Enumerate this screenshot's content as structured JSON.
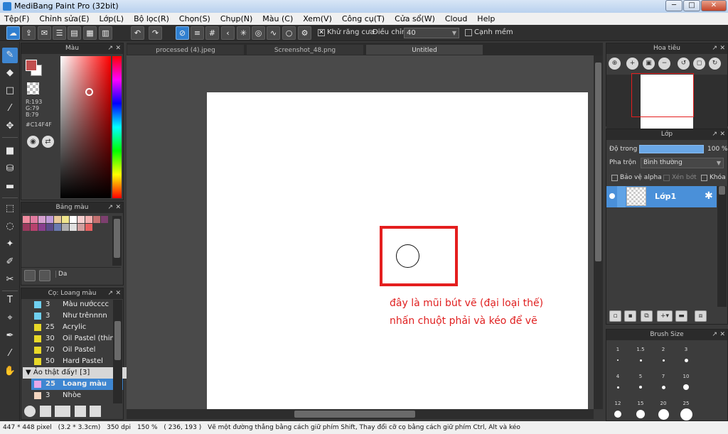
{
  "window": {
    "title": "MediBang Paint Pro (32bit)",
    "min": "─",
    "max": "□",
    "close": "✕"
  },
  "menu": [
    "Tệp(F)",
    "Chỉnh sửa(E)",
    "Lớp(L)",
    "Bộ lọc(R)",
    "Chọn(S)",
    "Chụp(N)",
    "Màu (C)",
    "Xem(V)",
    "Công cụ(T)",
    "Cửa sổ(W)",
    "Cloud",
    "Help"
  ],
  "toolbar": {
    "antialias_label": "Khử răng cưa",
    "correction_label": "Điều chỉnh",
    "correction_value": "40",
    "edge_label": "Cạnh mềm"
  },
  "color_panel": {
    "title": "Màu",
    "r": "R:193",
    "g": "G:79",
    "b": "B:79",
    "hex": "#C14F4F"
  },
  "palette_panel": {
    "title": "Bảng màu",
    "colors": [
      "#f08ca0",
      "#e27ba0",
      "#d6a0d0",
      "#c09ad8",
      "#e8c89a",
      "#f0e68c",
      "#ffffff",
      "#f8d0d0",
      "#f4b0b0",
      "#c47070",
      "#7d3f6f",
      "#9c3a5e",
      "#b8426e",
      "#8a3f8f",
      "#5c4a8a",
      "#6a7ab0",
      "#b0b0b0",
      "#e0e0e0",
      "#d0a0a0",
      "#e86060"
    ],
    "name": "Da"
  },
  "brush_panel": {
    "title": "Cọ: Loang màu",
    "items": [
      {
        "size": "3",
        "name": "Màu nướcccc",
        "color": "#6fd0f0"
      },
      {
        "size": "3",
        "name": "Như trênnnn",
        "color": "#6fd0f0"
      },
      {
        "size": "25",
        "name": "Acrylic",
        "color": "#e8d828"
      },
      {
        "size": "30",
        "name": "Oil Pastel (thin)",
        "color": "#e8d828"
      },
      {
        "size": "70",
        "name": "Oil Pastel",
        "color": "#e8d828"
      },
      {
        "size": "50",
        "name": "Hard Pastel",
        "color": "#e8d828"
      }
    ],
    "group": "Ảo thật đấy! [3]",
    "group_items": [
      {
        "size": "25",
        "name": "Loang màu",
        "color": "#e7a8e8",
        "selected": true
      },
      {
        "size": "3",
        "name": "Nhòe",
        "color": "#f4d6c0",
        "selected": false
      }
    ]
  },
  "doc_tabs": [
    "processed (4).jpeg",
    "Screenshot_48.png",
    "Untitled"
  ],
  "annotation": {
    "line1": "đây là mũi bút vẽ (đại loại thế)",
    "line2": "nhấn chuột phải và kéo để vẽ"
  },
  "navigator": {
    "title": "Hoa tiêu"
  },
  "layer_panel": {
    "title": "Lớp",
    "opacity_label": "Độ trong",
    "opacity_value": "100 %",
    "opacity": 1.0,
    "blend_label": "Pha trộn",
    "blend_value": "Bình thường",
    "protect_alpha": "Bảo vệ alpha",
    "clipping": "Xén bớt",
    "lock": "Khóa",
    "layer_name": "Lớp1"
  },
  "brush_size": {
    "title": "Brush Size",
    "sizes": [
      "1",
      "1.5",
      "2",
      "3",
      "4",
      "5",
      "7",
      "10",
      "12",
      "15",
      "20",
      "25"
    ]
  },
  "status": {
    "dimensions": "447 * 448 pixel",
    "cm": "(3.2 * 3.3cm)",
    "dpi": "350 dpi",
    "zoom": "150 %",
    "coords": "( 236, 193 )",
    "hint": "Vẽ một đường thẳng bằng cách giữ phím Shift, Thay đổi cỡ cọ bằng cách giữ phím Ctrl, Alt và kéo"
  }
}
